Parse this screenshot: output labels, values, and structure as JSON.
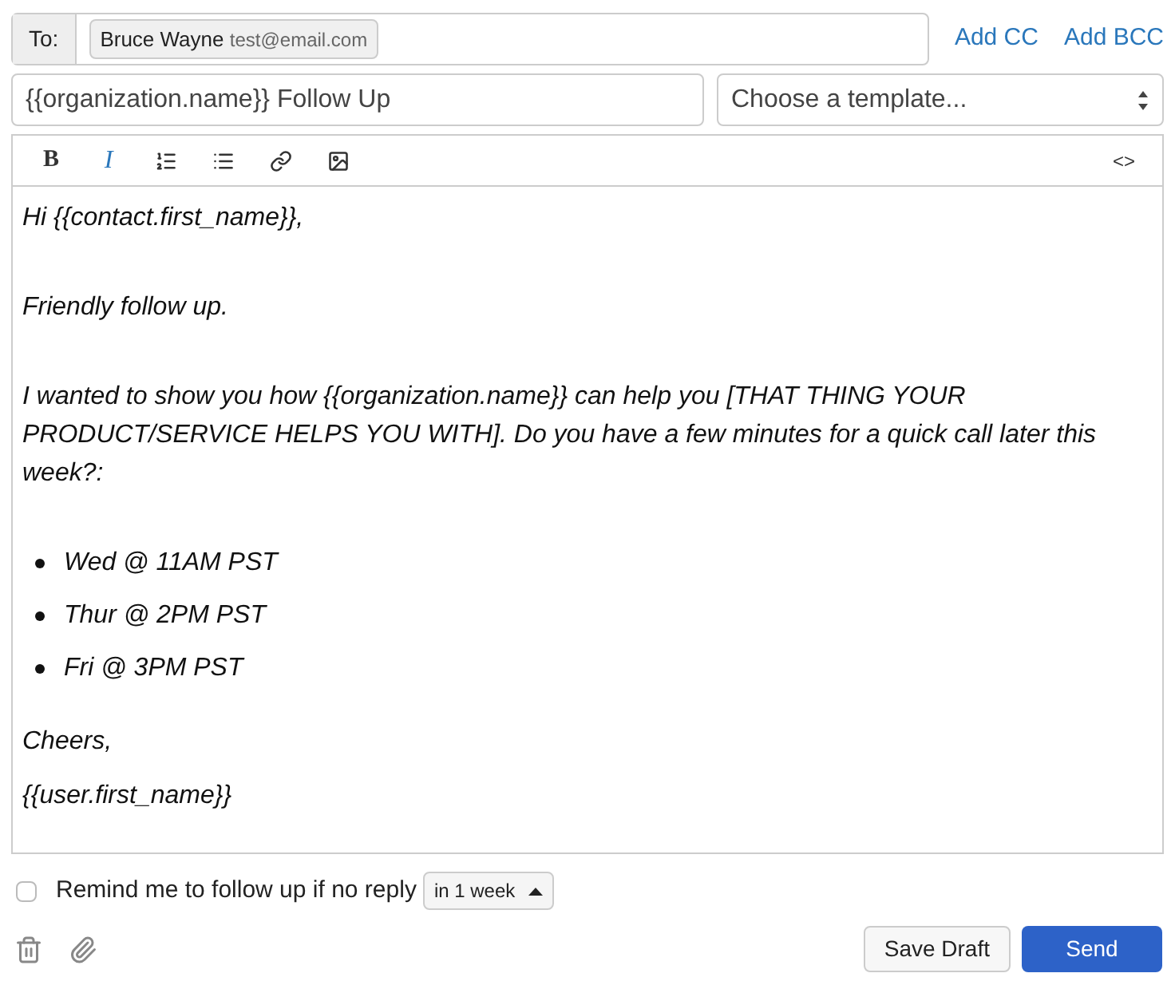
{
  "to": {
    "label": "To:",
    "recipients": [
      {
        "name": "Bruce Wayne",
        "email": "test@email.com"
      }
    ]
  },
  "links": [
    "Add CC",
    "Add BCC"
  ],
  "subject": {
    "value": "{{organization.name}} Follow Up"
  },
  "template": {
    "value": "Choose a template..."
  },
  "toolbar": [
    {
      "kind": "bold",
      "label": "B",
      "active": false
    },
    {
      "kind": "italic",
      "label": "I",
      "active": true
    },
    {
      "kind": "ordered-list",
      "active": false
    },
    {
      "kind": "bullet-list",
      "active": false
    },
    {
      "kind": "link",
      "active": false
    },
    {
      "kind": "image",
      "active": false
    },
    {
      "kind": "source",
      "label": "<>",
      "active": false
    }
  ],
  "body": [
    {
      "kind": "para",
      "text": "Hi {{contact.first_name}},"
    },
    {
      "kind": "para",
      "text": "Friendly follow up."
    },
    {
      "kind": "para",
      "text": "I wanted to show you how {{organization.name}} can help you [THAT THING YOUR PRODUCT/SERVICE HELPS YOU WITH]. Do you have a few minutes for a quick call later this week?:"
    },
    {
      "kind": "list",
      "items": [
        "Wed @ 11AM PST",
        "Thur @ 2PM PST",
        "Fri @ 3PM PST"
      ]
    },
    {
      "kind": "para",
      "text": "Cheers,"
    },
    {
      "kind": "para",
      "text": "{{user.first_name}}"
    }
  ],
  "reminder": {
    "checked": false,
    "label": "Remind me to follow up if no reply",
    "interval": "in 1 week"
  },
  "buttons": {
    "save": "Save Draft",
    "send": "Send"
  }
}
